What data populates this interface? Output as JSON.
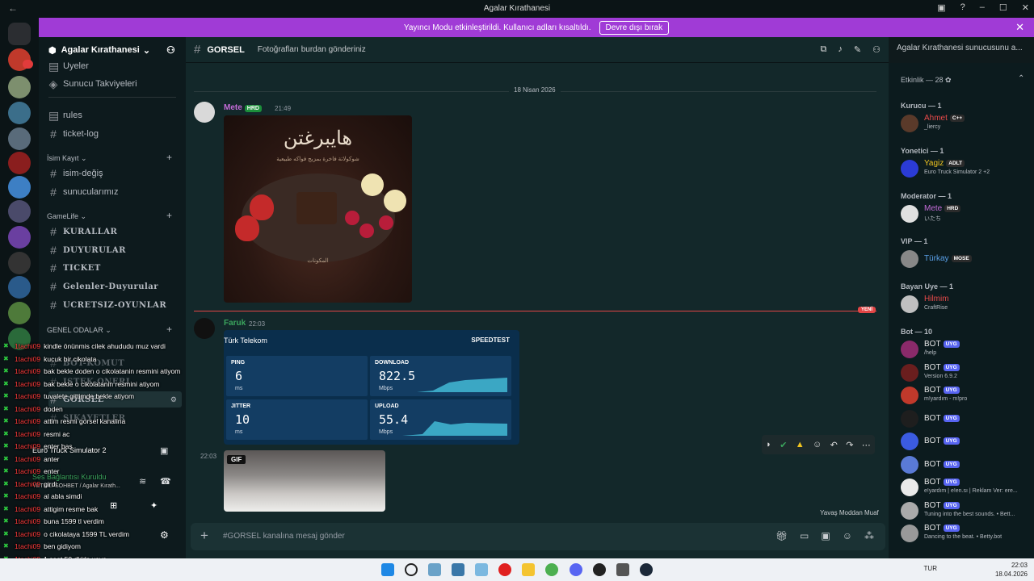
{
  "window": {
    "title": "Agalar Kırathanesi",
    "back": "←",
    "controls": [
      "–",
      "☐",
      "✕"
    ]
  },
  "banner": {
    "text": "Yayıncı Modu etkinleştirildi. Kullanıcı adları kısaltıldı.",
    "button": "Devre dışı bırak",
    "close": "✕"
  },
  "server": {
    "name": "Agalar Kırathanesi"
  },
  "channels": {
    "top": [
      {
        "name": "Uyeler"
      },
      {
        "name": "Sunucu Takviyeleri"
      }
    ],
    "plain": [
      {
        "name": "rules"
      },
      {
        "name": "ticket-log"
      }
    ],
    "cat_isim": "İsim Kayıt",
    "isim": [
      {
        "name": "isim-değiş"
      },
      {
        "name": "sunucularımız"
      }
    ],
    "cat_gamelife": "GameLife",
    "gamelife": [
      {
        "name": "KURALLAR"
      },
      {
        "name": "DUYURULAR"
      },
      {
        "name": "TICKET"
      },
      {
        "name": "Gelenler-Duyurular"
      },
      {
        "name": "UCRETSIZ-OYUNLAR"
      }
    ],
    "cat_genel": "GENEL ODALAR",
    "genel": [
      {
        "name": "BOT-KOMUT"
      },
      {
        "name": "ISTEK-ONERI"
      },
      {
        "name": "GORSEL"
      },
      {
        "name": "SIKAYETLER"
      }
    ]
  },
  "overlay_chat": [
    {
      "user": "1tachi09",
      "text": "kindle önünmis cilek ahududu muz vardi"
    },
    {
      "user": "1tachi09",
      "text": "kucuk bir cikolata"
    },
    {
      "user": "1tachi09",
      "text": "bak bekle doden o cikolatanin resmini atiyom"
    },
    {
      "user": "1tachi09",
      "text": "bak bekle o cikolatanin resmini atiyom"
    },
    {
      "user": "1tachi09",
      "text": "tuvalete gittimde bekle atiyom"
    },
    {
      "user": "1tachi09",
      "text": "doden"
    },
    {
      "user": "1tachi09",
      "text": "attim resmi gorsel kanalina"
    },
    {
      "user": "1tachi09",
      "text": "resmi ac"
    },
    {
      "user": "1tachi09",
      "text": "enter bas"
    },
    {
      "user": "1tachi09",
      "text": "anter"
    },
    {
      "user": "1tachi09",
      "text": "enter"
    },
    {
      "user": "1tachi09",
      "text": "girdi"
    },
    {
      "user": "1tachi09",
      "text": "al abla simdi"
    },
    {
      "user": "1tachi09",
      "text": "attigim resme bak"
    },
    {
      "user": "1tachi09",
      "text": "buna 1599 tl verdim"
    },
    {
      "user": "1tachi09",
      "text": "o cikolataya 1599 TL verdim"
    },
    {
      "user": "1tachi09",
      "text": "ben gidiyom"
    },
    {
      "user": "1tachi09",
      "text": "1 saat 50 dk'da veya..."
    },
    {
      "user": "1tachi09",
      "text": ""
    }
  ],
  "userpanel": {
    "game": "Euro Truck Simulator 2",
    "voice_status": "Ses Bağlantısı Kuruldu",
    "voice_channel": "YETKILI SOHBET / Agalar Kırath..."
  },
  "channel_header": {
    "name": "GORSEL",
    "topic": "Fotoğrafları burdan gönderiniz",
    "search": "Agalar Kırathanesi sunucusunu a..."
  },
  "date_divider": "18 Nisan 2026",
  "messages": [
    {
      "user": "Mete",
      "badge": "HRD",
      "time": "21:49",
      "color": "#c46bd8",
      "image": {
        "title": "هايبرغتن",
        "subtitle": "شوكولاتة فاخرة بمزيج فواكه طبيعية",
        "footer": "المكونات"
      }
    },
    {
      "user": "Faruk",
      "time": "22:03",
      "color": "#3ba55d",
      "speedtest": {
        "isp": "Türk Telekom",
        "brand": "SPEEDTEST",
        "ping": {
          "label": "PING",
          "value": "6",
          "unit": "ms"
        },
        "download": {
          "label": "DOWNLOAD",
          "value": "822.5",
          "unit": "Mbps"
        },
        "jitter": {
          "label": "JITTER",
          "value": "10",
          "unit": "ms"
        },
        "upload": {
          "label": "UPLOAD",
          "value": "55.4",
          "unit": "Mbps"
        }
      }
    },
    {
      "time": "22:03",
      "gif_tag": "GIF"
    }
  ],
  "new_badge": "YENİ",
  "slowmode": "Yavaş Moddan Muaf",
  "composer": {
    "placeholder": "#GORSEL kanalına mesaj gönder"
  },
  "members": {
    "activity_header": "Etkinlik — 28",
    "groups": [
      {
        "title": "Kurucu — 1",
        "members": [
          {
            "name": "Ahmet",
            "badge": "C++",
            "activity": "_liercy",
            "color": "#e84a4a"
          }
        ]
      },
      {
        "title": "Yonetici — 1",
        "members": [
          {
            "name": "Yagiz",
            "badge": "ADLT",
            "activity": "Euro Truck Simulator 2 +2",
            "color": "#f0c420"
          }
        ]
      },
      {
        "title": "Moderator — 1",
        "members": [
          {
            "name": "Mete",
            "badge": "HRD",
            "activity": "いたち",
            "color": "#c46bd8"
          }
        ]
      },
      {
        "title": "VIP — 1",
        "members": [
          {
            "name": "Türkay",
            "badge": "MOSE",
            "activity": "",
            "color": "#5aa0e8"
          }
        ]
      },
      {
        "title": "Bayan Uye — 1",
        "members": [
          {
            "name": "Hilmim",
            "badge": "",
            "activity": "CraftRise",
            "color": "#e84a4a"
          }
        ]
      },
      {
        "title": "Bot — 10",
        "members": [
          {
            "name": "BOT",
            "badge": "UYG",
            "activity": "/help",
            "color": "#e6e6e6"
          },
          {
            "name": "BOT",
            "badge": "UYG",
            "activity": "Version 6.9.2",
            "color": "#e6e6e6"
          },
          {
            "name": "BOT",
            "badge": "UYG",
            "activity": "m!yardım - m!pro",
            "color": "#e6e6e6"
          },
          {
            "name": "BOT",
            "badge": "UYG",
            "activity": "",
            "color": "#e6e6e6"
          },
          {
            "name": "BOT",
            "badge": "UYG",
            "activity": "",
            "color": "#e6e6e6"
          },
          {
            "name": "BOT",
            "badge": "UYG",
            "activity": "",
            "color": "#e6e6e6"
          },
          {
            "name": "BOT",
            "badge": "UYG",
            "activity": "e!yardım | e!en.sı | Reklam Ver: ere...",
            "color": "#e6e6e6"
          },
          {
            "name": "BOT",
            "badge": "UYG",
            "activity": "Tuning into the best sounds. • Bett...",
            "color": "#e6e6e6"
          },
          {
            "name": "BOT",
            "badge": "UYG",
            "activity": "Dancing to the beat. • Betty.bot",
            "color": "#e6e6e6"
          }
        ]
      }
    ]
  },
  "taskbar": {
    "lang": "TUR",
    "time": "22:03",
    "date": "18.04.2026"
  }
}
